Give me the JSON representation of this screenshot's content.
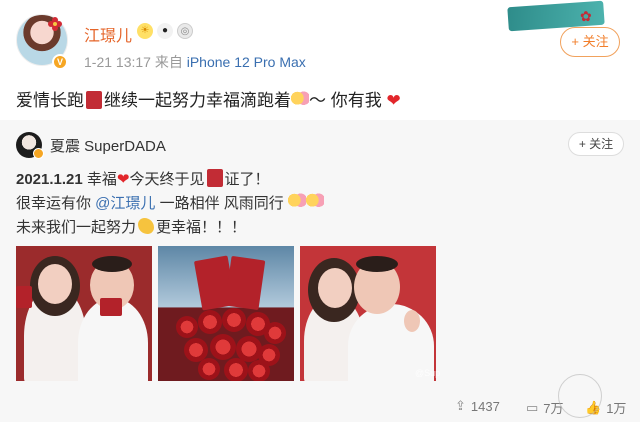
{
  "post": {
    "username": "江璟儿",
    "timestamp": "1-21 13:17",
    "source_prefix": "来自",
    "device": "iPhone 12 Pro Max",
    "follow_label": "+ 关注",
    "text_part1": "爱情长跑",
    "text_part2": "继续一起努力幸福滴跑着",
    "text_part3": "～ 你有我",
    "heart": "❤"
  },
  "repost": {
    "username": "夏震 SuperDADA",
    "follow_label": "+ 关注",
    "line1_date": "2021.1.21",
    "line1_part1": " 幸福",
    "line1_part2": "今天终于见",
    "line1_part3": "证了！",
    "line2_part1": "很幸运有你 ",
    "line2_mention": "@江璟儿",
    "line2_part2": " 一路相伴 风雨同行",
    "line3_part1": "未来我们一起努力",
    "line3_part2": "更幸福！！！",
    "watermark": "@Sup",
    "stats": {
      "shares": "1437",
      "comments": "7万",
      "likes": "1万"
    }
  },
  "colors": {
    "username": "#e5652a",
    "link": "#3a6fb0",
    "follow_border": "#f1a25d",
    "heart": "#e2262b"
  },
  "icons": [
    "share-icon",
    "comment-icon",
    "like-icon",
    "vip-badge-icon",
    "panda-badge-icon",
    "medal-badge-icon"
  ]
}
